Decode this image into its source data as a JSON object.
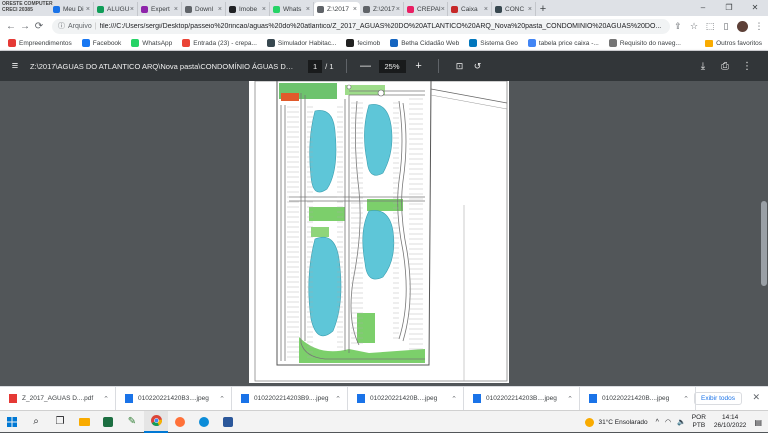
{
  "watermark": {
    "line1": "ORESTE COMPUTER",
    "line2": "CRECI 20385"
  },
  "tabs": [
    {
      "label": "Meu Di",
      "color": "#1a73e8"
    },
    {
      "label": "ALUGU",
      "color": "#0f9d58"
    },
    {
      "label": "Expert",
      "color": "#8e24aa"
    },
    {
      "label": "Downl",
      "color": "#5f6368"
    },
    {
      "label": "Imobe",
      "color": "#202124"
    },
    {
      "label": "Whats",
      "color": "#25d366"
    },
    {
      "label": "Z:\\2017",
      "color": "#5f6368",
      "active": true
    },
    {
      "label": "Z:\\2017",
      "color": "#5f6368"
    },
    {
      "label": "CREPAI",
      "color": "#e91e63"
    },
    {
      "label": "Caixa",
      "color": "#c62828"
    },
    {
      "label": "CONC",
      "color": "#37474f"
    }
  ],
  "window": {
    "minimize": "–",
    "maximize": "❐",
    "close": "✕"
  },
  "omnibar": {
    "back": "←",
    "forward": "→",
    "reload": "⟳",
    "info": "ⓘ",
    "security_label": "Arquivo",
    "url": "file:///C:/Users/sergi/Desktop/passeio%20rincao/aguas%20do%20atlantico/Z_2017_AGUAS%20DO%20ATLANTICO%20ARQ_Nova%20pasta_CONDOMINIO%20ÁGUAS%20DO..."
  },
  "bookmarks": [
    {
      "label": "Empreendimentos",
      "color": "#e53935"
    },
    {
      "label": "Facebook",
      "color": "#1877f2"
    },
    {
      "label": "WhatsApp",
      "color": "#25d366"
    },
    {
      "label": "Entrada (23) - crepa...",
      "color": "#ea4335"
    },
    {
      "label": "Simulador Habitac...",
      "color": "#37474f"
    },
    {
      "label": "fecimob",
      "color": "#212121"
    },
    {
      "label": "Betha Cidadão Web",
      "color": "#1565c0"
    },
    {
      "label": "Sistema Geo",
      "color": "#0277bd"
    },
    {
      "label": "tabela price caixa -...",
      "color": "#4285f4"
    },
    {
      "label": "Requisito do naveg...",
      "color": "#757575"
    }
  ],
  "bookmarks_other": "Outros favoritos",
  "pdf": {
    "title": "Z:\\2017\\AGUAS DO ATLANTICO ARQ\\Nova pasta\\CONDOMÍNIO ÁGUAS DO ATLÂNTI...",
    "page_current": "1",
    "page_total": "/  1",
    "zoom": "25%",
    "zoom_minus": "—",
    "zoom_plus": "+"
  },
  "downloads": [
    {
      "label": "Z_2017_AGUAS D....pdf",
      "color": "#e53935"
    },
    {
      "label": "010220221420B3....jpeg",
      "color": "#1a73e8"
    },
    {
      "label": "0102202214203B9....jpeg",
      "color": "#1a73e8"
    },
    {
      "label": "010220221420B....jpeg",
      "color": "#1a73e8"
    },
    {
      "label": "0102202214203B....jpeg",
      "color": "#1a73e8"
    },
    {
      "label": "010220221420B....jpeg",
      "color": "#1a73e8"
    }
  ],
  "downloads_show_all": "Exibir todos",
  "taskbar": {
    "weather": "31°C  Ensolarado",
    "lang_1": "POR",
    "lang_2": "PTB",
    "time": "14:14",
    "date": "26/10/2022"
  }
}
